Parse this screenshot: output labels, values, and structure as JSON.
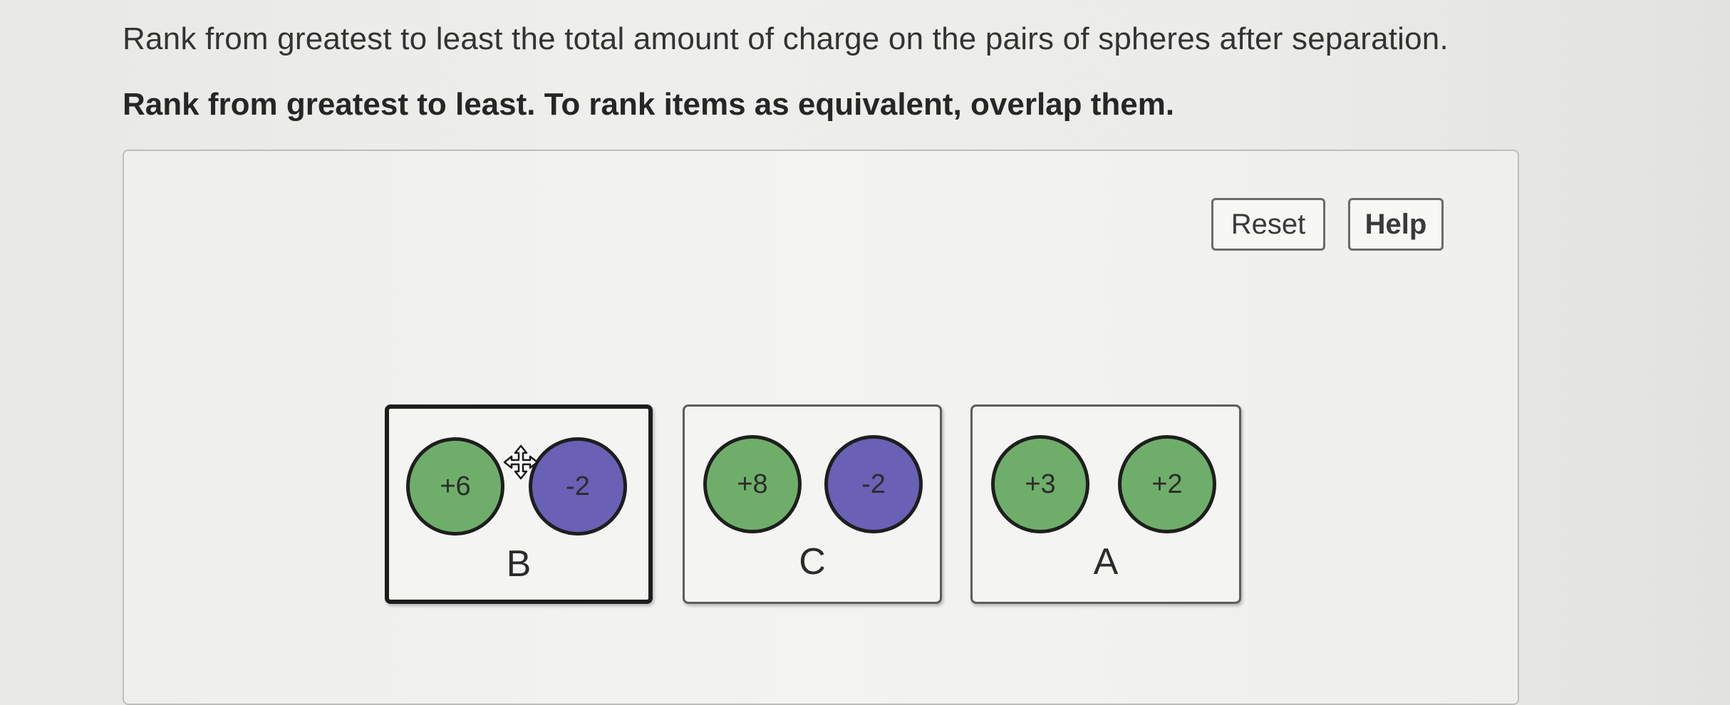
{
  "prompt": {
    "question": "Rank from greatest to least the total amount of charge on the pairs of spheres after separation.",
    "instruction": "Rank from greatest to least. To rank items as equivalent, overlap them."
  },
  "toolbar": {
    "reset_label": "Reset",
    "help_label": "Help"
  },
  "colors": {
    "positive_sphere": "#6fae6a",
    "negative_sphere": "#6a60b6"
  },
  "cards": [
    {
      "label": "B",
      "selected": true,
      "spheres": [
        {
          "charge": "+6",
          "kind": "positive"
        },
        {
          "charge": "-2",
          "kind": "negative"
        }
      ]
    },
    {
      "label": "C",
      "selected": false,
      "spheres": [
        {
          "charge": "+8",
          "kind": "positive"
        },
        {
          "charge": "-2",
          "kind": "negative"
        }
      ]
    },
    {
      "label": "A",
      "selected": false,
      "spheres": [
        {
          "charge": "+3",
          "kind": "positive"
        },
        {
          "charge": "+2",
          "kind": "positive"
        }
      ]
    }
  ],
  "cursor_icon": "move-cursor-icon"
}
